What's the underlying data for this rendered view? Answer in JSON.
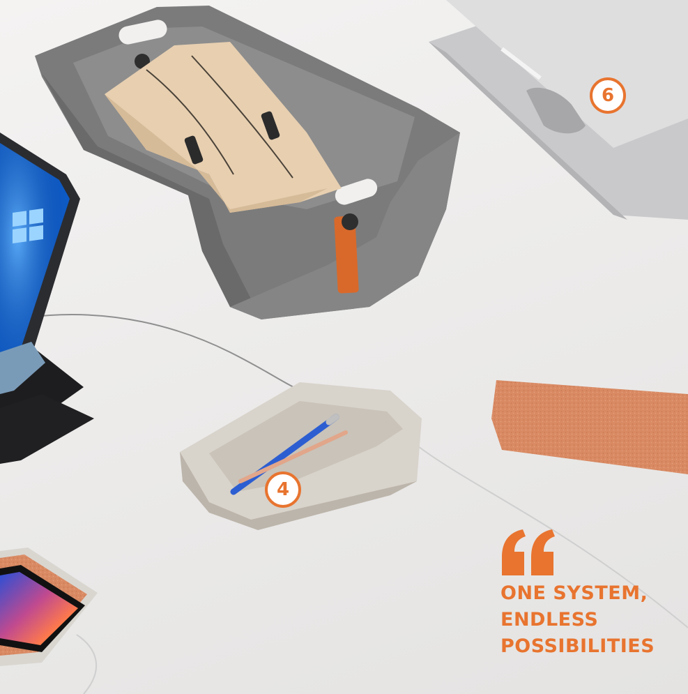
{
  "callouts": [
    {
      "number": "6",
      "object": "laptop-stand"
    },
    {
      "number": "4",
      "object": "pen-tray"
    }
  ],
  "quote": {
    "lines": [
      "ONE SYSTEM,",
      "ENDLESS",
      "POSSIBILITIES"
    ]
  },
  "colors": {
    "accent": "#e8742f",
    "felt_grey": "#7b7b7b",
    "tray_beige": "#d8d3cb",
    "cork": "#d98a63",
    "background": "#ecebea"
  },
  "icons": {
    "quote_mark": "left-double-quote-icon"
  }
}
